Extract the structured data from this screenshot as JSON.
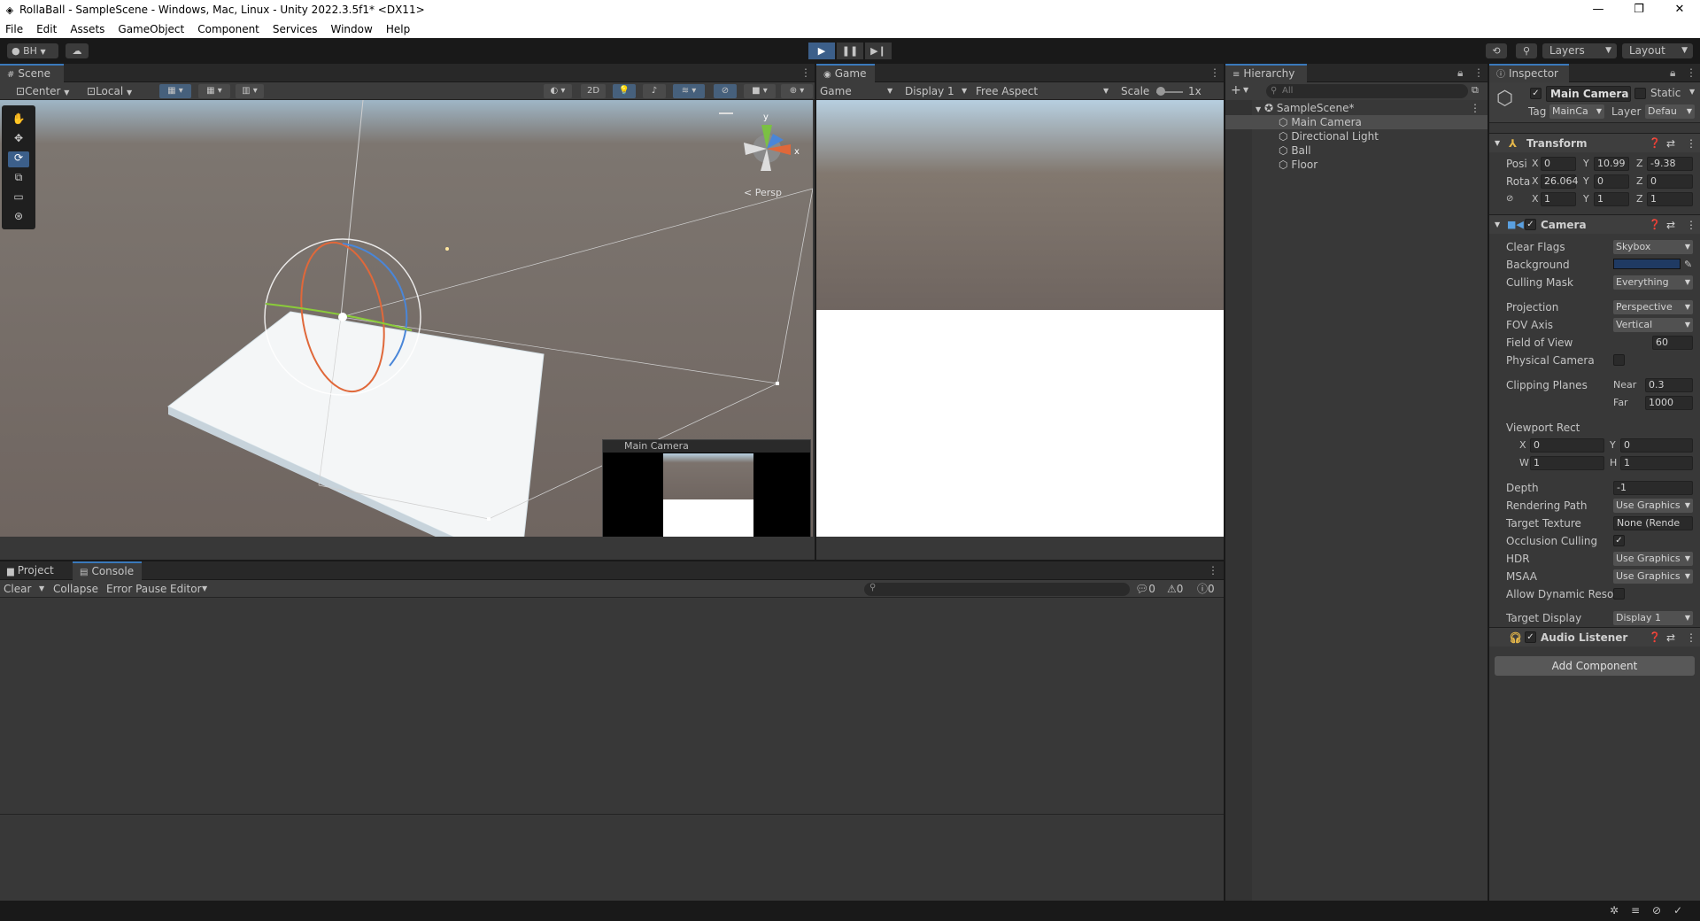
{
  "window": {
    "title": "RollaBall - SampleScene - Windows, Mac, Linux - Unity 2022.3.5f1* <DX11>"
  },
  "menu": [
    "File",
    "Edit",
    "Assets",
    "GameObject",
    "Component",
    "Services",
    "Window",
    "Help"
  ],
  "toolbar": {
    "account": "BH",
    "layers": "Layers",
    "layout": "Layout"
  },
  "scene": {
    "tab": "Scene",
    "pivot": "Center",
    "space": "Local",
    "mode2d": "2D",
    "persp": "< Persp",
    "camera_preview_title": "Main Camera"
  },
  "game": {
    "tab": "Game",
    "view_select": "Game",
    "display": "Display 1",
    "aspect": "Free Aspect",
    "scale_label": "Scale",
    "scale_value": "1x"
  },
  "hierarchy": {
    "tab": "Hierarchy",
    "search_placeholder": "All",
    "scene_name": "SampleScene*",
    "items": [
      "Main Camera",
      "Directional Light",
      "Ball",
      "Floor"
    ]
  },
  "inspector": {
    "tab": "Inspector",
    "object_name": "Main Camera",
    "static_label": "Static",
    "tag_label": "Tag",
    "tag_value": "MainCa",
    "layer_label": "Layer",
    "layer_value": "Defau",
    "transform": {
      "title": "Transform",
      "position_label": "Posi",
      "rotation_label": "Rota",
      "scale_label": "",
      "position": {
        "x": "0",
        "y": "10.99",
        "z": "-9.38"
      },
      "rotation": {
        "x": "26.064",
        "y": "0",
        "z": "0"
      },
      "scale": {
        "x": "1",
        "y": "1",
        "z": "1"
      }
    },
    "camera": {
      "title": "Camera",
      "clear_flags_label": "Clear Flags",
      "clear_flags": "Skybox",
      "background_label": "Background",
      "background_color": "#1f3a63",
      "culling_mask_label": "Culling Mask",
      "culling_mask": "Everything",
      "projection_label": "Projection",
      "projection": "Perspective",
      "fov_axis_label": "FOV Axis",
      "fov_axis": "Vertical",
      "fov_label": "Field of View",
      "fov": "60",
      "physical_label": "Physical Camera",
      "clipping_label": "Clipping Planes",
      "near_label": "Near",
      "near": "0.3",
      "far_label": "Far",
      "far": "1000",
      "viewport_label": "Viewport Rect",
      "vx_label": "X",
      "vx": "0",
      "vy_label": "Y",
      "vy": "0",
      "vw_label": "W",
      "vw": "1",
      "vh_label": "H",
      "vh": "1",
      "depth_label": "Depth",
      "depth": "-1",
      "rendering_path_label": "Rendering Path",
      "rendering_path": "Use Graphics",
      "target_texture_label": "Target Texture",
      "target_texture": "None (Rende",
      "occlusion_label": "Occlusion Culling",
      "hdr_label": "HDR",
      "hdr": "Use Graphics",
      "msaa_label": "MSAA",
      "msaa": "Use Graphics",
      "dynamic_res_label": "Allow Dynamic Resol",
      "target_display_label": "Target Display",
      "target_display": "Display 1"
    },
    "audio_listener": {
      "title": "Audio Listener"
    },
    "add_component": "Add Component"
  },
  "console": {
    "tab_project": "Project",
    "tab_console": "Console",
    "clear": "Clear",
    "collapse": "Collapse",
    "error_pause": "Error Pause",
    "editor": "Editor",
    "count_log": "0",
    "count_warn": "0",
    "count_error": "0"
  }
}
